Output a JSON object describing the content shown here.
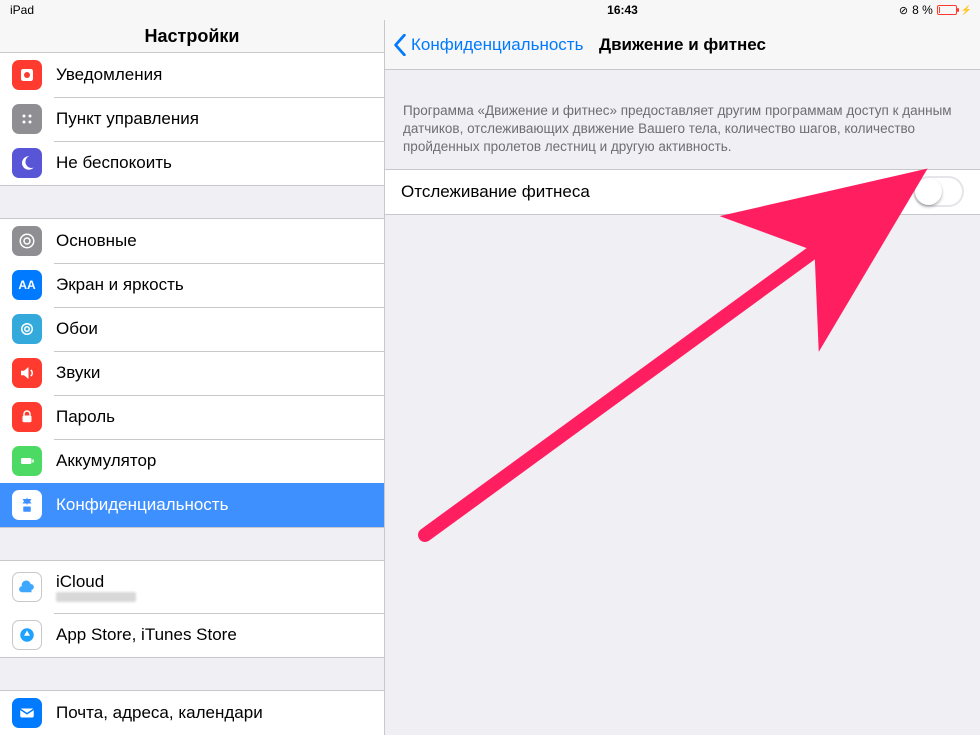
{
  "status": {
    "device": "iPad",
    "time": "16:43",
    "battery_text": "8 %"
  },
  "sidebar": {
    "title": "Настройки",
    "groups": [
      {
        "items": [
          {
            "id": "notifications",
            "label": "Уведомления"
          },
          {
            "id": "control-center",
            "label": "Пункт управления"
          },
          {
            "id": "dnd",
            "label": "Не беспокоить"
          }
        ]
      },
      {
        "items": [
          {
            "id": "general",
            "label": "Основные"
          },
          {
            "id": "display",
            "label": "Экран и яркость"
          },
          {
            "id": "wallpaper",
            "label": "Обои"
          },
          {
            "id": "sounds",
            "label": "Звуки"
          },
          {
            "id": "passcode",
            "label": "Пароль"
          },
          {
            "id": "battery",
            "label": "Аккумулятор"
          },
          {
            "id": "privacy",
            "label": "Конфиденциальность",
            "selected": true
          }
        ]
      },
      {
        "items": [
          {
            "id": "icloud",
            "label": "iCloud",
            "subtitle": ""
          },
          {
            "id": "appstore",
            "label": "App Store, iTunes Store"
          }
        ]
      },
      {
        "items": [
          {
            "id": "mail",
            "label": "Почта, адреса, календари"
          }
        ]
      }
    ]
  },
  "main": {
    "back_label": "Конфиденциальность",
    "title": "Движение и фитнес",
    "description": "Программа «Движение и фитнес» предоставляет другим программам доступ к данным датчиков, отслеживающих движение Вашего тела, количество шагов, количество пройденных пролетов лестниц и другую активность.",
    "toggle_label": "Отслеживание фитнеса",
    "toggle_on": false
  },
  "annotation": {
    "arrow_color": "#ff1f60"
  }
}
